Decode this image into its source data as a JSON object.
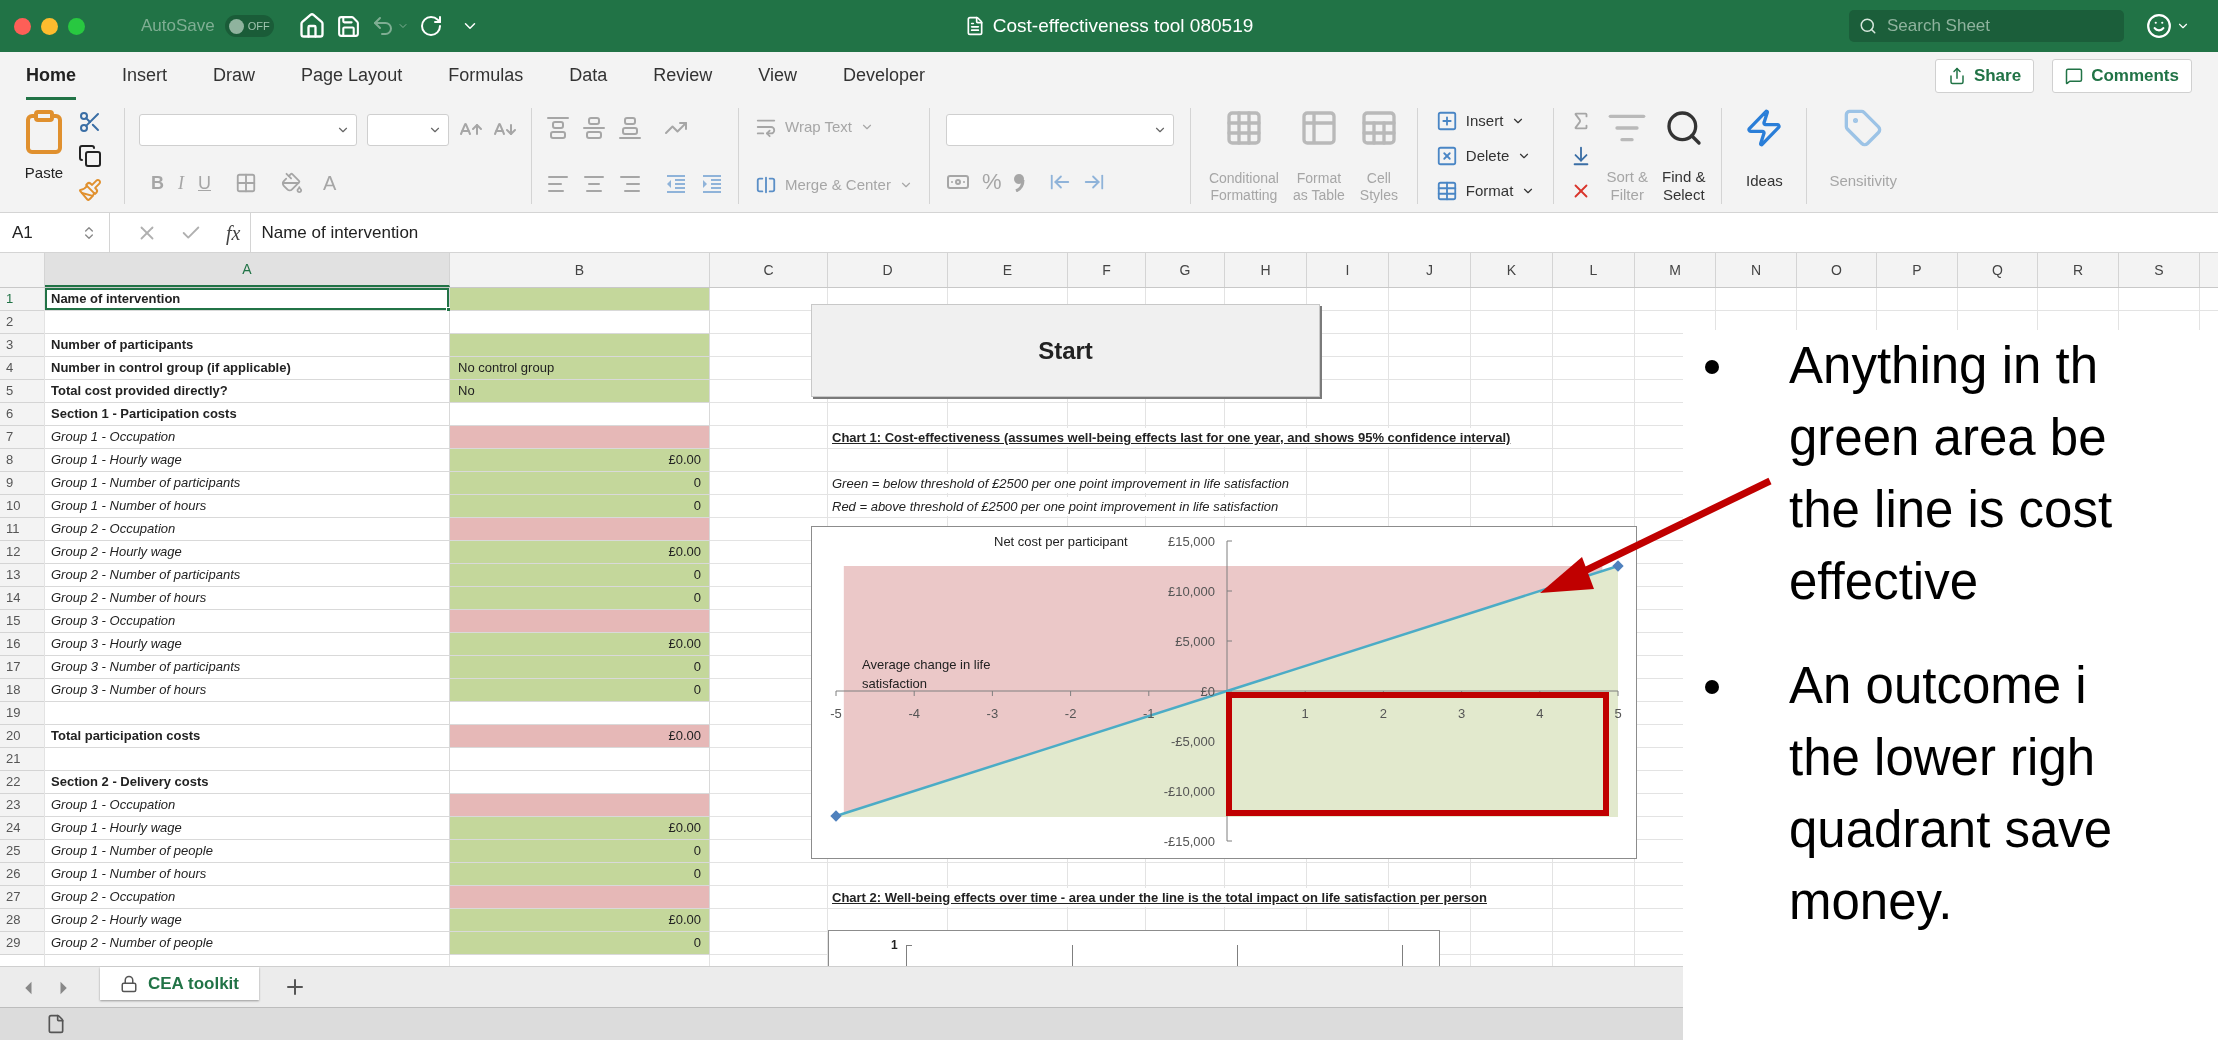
{
  "window": {
    "autosave_label": "AutoSave",
    "autosave_state": "OFF",
    "title": "Cost-effectiveness tool 080519",
    "search_placeholder": "Search Sheet"
  },
  "ribbon_tabs": [
    {
      "label": "Home",
      "selected": true
    },
    {
      "label": "Insert",
      "selected": false
    },
    {
      "label": "Draw",
      "selected": false
    },
    {
      "label": "Page Layout",
      "selected": false
    },
    {
      "label": "Formulas",
      "selected": false
    },
    {
      "label": "Data",
      "selected": false
    },
    {
      "label": "Review",
      "selected": false
    },
    {
      "label": "View",
      "selected": false
    },
    {
      "label": "Developer",
      "selected": false
    }
  ],
  "share_button": "Share",
  "comments_button": "Comments",
  "ribbon": {
    "paste": "Paste",
    "font_buttons": [
      {
        "label": "B",
        "disabled": true
      },
      {
        "label": "I",
        "disabled": true
      },
      {
        "label": "U",
        "disabled": true
      }
    ],
    "font_color": "A",
    "wrap_text": {
      "label": "Wrap Text",
      "disabled": true
    },
    "merge_center": {
      "label": "Merge & Center",
      "disabled": true
    },
    "percent": "%",
    "styles": [
      {
        "lines": [
          "Conditional",
          "Formatting"
        ],
        "disabled": true
      },
      {
        "lines": [
          "Format",
          "as Table"
        ],
        "disabled": true
      },
      {
        "lines": [
          "Cell",
          "Styles"
        ],
        "disabled": true
      }
    ],
    "cells": [
      {
        "label": "Insert",
        "disabled": false
      },
      {
        "label": "Delete",
        "disabled": false
      },
      {
        "label": "Format",
        "disabled": false
      }
    ],
    "editing": [
      {
        "lines": [
          "Sort &",
          "Filter"
        ],
        "disabled": true
      },
      {
        "lines": [
          "Find &",
          "Select"
        ],
        "disabled": false
      }
    ],
    "ideas": {
      "label": "Ideas",
      "disabled": false
    },
    "sensitivity": {
      "label": "Sensitivity",
      "disabled": true
    }
  },
  "formula_bar": {
    "name_box": "A1",
    "fx": "fx",
    "content": "Name of intervention"
  },
  "columns": [
    {
      "label": "A",
      "selected": true
    },
    {
      "label": "B",
      "selected": false
    },
    {
      "label": "C",
      "selected": false
    },
    {
      "label": "D",
      "selected": false
    },
    {
      "label": "E",
      "selected": false
    },
    {
      "label": "F",
      "selected": false
    },
    {
      "label": "G",
      "selected": false
    },
    {
      "label": "H",
      "selected": false
    },
    {
      "label": "I",
      "selected": false
    },
    {
      "label": "J",
      "selected": false
    },
    {
      "label": "K",
      "selected": false
    },
    {
      "label": "L",
      "selected": false
    },
    {
      "label": "M",
      "selected": false
    },
    {
      "label": "N",
      "selected": false
    },
    {
      "label": "O",
      "selected": false
    },
    {
      "label": "P",
      "selected": false
    },
    {
      "label": "Q",
      "selected": false
    },
    {
      "label": "R",
      "selected": false
    },
    {
      "label": "S",
      "selected": false
    }
  ],
  "rows": [
    {
      "number": "1",
      "a": {
        "text": "Name of intervention",
        "bold": true,
        "italic": false,
        "selected": true
      },
      "b": {
        "color": "#c4d79b"
      }
    },
    {
      "number": "2",
      "a": {
        "selected": false
      },
      "b": {}
    },
    {
      "number": "3",
      "a": {
        "text": "Number of participants",
        "bold": true,
        "italic": false,
        "selected": false
      },
      "b": {
        "color": "#c4d79b"
      }
    },
    {
      "number": "4",
      "a": {
        "text": "Number in control group (if applicable)",
        "bold": true,
        "italic": false,
        "selected": false
      },
      "b": {
        "text": "No control group",
        "right_aligned": false,
        "color": "#c4d79b"
      }
    },
    {
      "number": "5",
      "a": {
        "text": "Total cost provided directly?",
        "bold": true,
        "italic": false,
        "selected": false
      },
      "b": {
        "text": "No",
        "right_aligned": false,
        "color": "#c4d79b"
      }
    },
    {
      "number": "6",
      "a": {
        "text": "Section 1 - Participation costs",
        "bold": true,
        "italic": false,
        "selected": false
      },
      "b": {}
    },
    {
      "number": "7",
      "a": {
        "text": "Group 1 - Occupation",
        "bold": false,
        "italic": true,
        "selected": false
      },
      "b": {
        "color": "#e6b8b7"
      },
      "d": {
        "text": "Chart 1: Cost-effectiveness (assumes well-being effects last for one year, and shows 95% confidence interval)",
        "bold": true,
        "italic": false,
        "underline": true
      }
    },
    {
      "number": "8",
      "a": {
        "text": "Group 1 - Hourly wage",
        "bold": false,
        "italic": true,
        "selected": false
      },
      "b": {
        "text": "£0.00",
        "right_aligned": true,
        "color": "#c4d79b"
      }
    },
    {
      "number": "9",
      "a": {
        "text": "Group 1 - Number of participants",
        "bold": false,
        "italic": true,
        "selected": false
      },
      "b": {
        "text": "0",
        "right_aligned": true,
        "color": "#c4d79b"
      },
      "d": {
        "text": "Green = below threshold of £2500 per one point improvement in life satisfaction",
        "bold": false,
        "italic": true,
        "underline": false
      }
    },
    {
      "number": "10",
      "a": {
        "text": "Group 1 - Number of hours",
        "bold": false,
        "italic": true,
        "selected": false
      },
      "b": {
        "text": "0",
        "right_aligned": true,
        "color": "#c4d79b"
      },
      "d": {
        "text": "Red = above threshold of £2500 per one point improvement in life satisfaction",
        "bold": false,
        "italic": true,
        "underline": false
      }
    },
    {
      "number": "11",
      "a": {
        "text": "Group 2 - Occupation",
        "bold": false,
        "italic": true,
        "selected": false
      },
      "b": {
        "color": "#e6b8b7"
      }
    },
    {
      "number": "12",
      "a": {
        "text": "Group 2 - Hourly wage",
        "bold": false,
        "italic": true,
        "selected": false
      },
      "b": {
        "text": "£0.00",
        "right_aligned": true,
        "color": "#c4d79b"
      }
    },
    {
      "number": "13",
      "a": {
        "text": "Group 2 - Number of participants",
        "bold": false,
        "italic": true,
        "selected": false
      },
      "b": {
        "text": "0",
        "right_aligned": true,
        "color": "#c4d79b"
      }
    },
    {
      "number": "14",
      "a": {
        "text": "Group 2 - Number of hours",
        "bold": false,
        "italic": true,
        "selected": false
      },
      "b": {
        "text": "0",
        "right_aligned": true,
        "color": "#c4d79b"
      }
    },
    {
      "number": "15",
      "a": {
        "text": "Group 3 - Occupation",
        "bold": false,
        "italic": true,
        "selected": false
      },
      "b": {
        "color": "#e6b8b7"
      }
    },
    {
      "number": "16",
      "a": {
        "text": "Group 3 - Hourly wage",
        "bold": false,
        "italic": true,
        "selected": false
      },
      "b": {
        "text": "£0.00",
        "right_aligned": true,
        "color": "#c4d79b"
      }
    },
    {
      "number": "17",
      "a": {
        "text": "Group 3 - Number of participants",
        "bold": false,
        "italic": true,
        "selected": false
      },
      "b": {
        "text": "0",
        "right_aligned": true,
        "color": "#c4d79b"
      }
    },
    {
      "number": "18",
      "a": {
        "text": "Group 3 - Number of hours",
        "bold": false,
        "italic": true,
        "selected": false
      },
      "b": {
        "text": "0",
        "right_aligned": true,
        "color": "#c4d79b"
      }
    },
    {
      "number": "19",
      "a": {
        "selected": false
      },
      "b": {}
    },
    {
      "number": "20",
      "a": {
        "text": "Total participation costs",
        "bold": true,
        "italic": false,
        "selected": false
      },
      "b": {
        "text": "£0.00",
        "right_aligned": true,
        "color": "#e6b8b7"
      }
    },
    {
      "number": "21",
      "a": {
        "selected": false
      },
      "b": {}
    },
    {
      "number": "22",
      "a": {
        "text": "Section 2 - Delivery costs",
        "bold": true,
        "italic": false,
        "selected": false
      },
      "b": {}
    },
    {
      "number": "23",
      "a": {
        "text": "Group 1 - Occupation",
        "bold": false,
        "italic": true,
        "selected": false
      },
      "b": {
        "color": "#e6b8b7"
      }
    },
    {
      "number": "24",
      "a": {
        "text": "Group 1 - Hourly wage",
        "bold": false,
        "italic": true,
        "selected": false
      },
      "b": {
        "text": "£0.00",
        "right_aligned": true,
        "color": "#c4d79b"
      }
    },
    {
      "number": "25",
      "a": {
        "text": "Group 1 - Number of people",
        "bold": false,
        "italic": true,
        "selected": false
      },
      "b": {
        "text": "0",
        "right_aligned": true,
        "color": "#c4d79b"
      }
    },
    {
      "number": "26",
      "a": {
        "text": "Group 1 - Number of hours",
        "bold": false,
        "italic": true,
        "selected": false
      },
      "b": {
        "text": "0",
        "right_aligned": true,
        "color": "#c4d79b"
      }
    },
    {
      "number": "27",
      "a": {
        "text": "Group 2 - Occupation",
        "bold": false,
        "italic": true,
        "selected": false
      },
      "b": {
        "color": "#e6b8b7"
      },
      "d": {
        "text": "Chart 2: Well-being effects over time - area under the line is the total impact on life satisfaction per person",
        "bold": true,
        "italic": false,
        "underline": true
      }
    },
    {
      "number": "28",
      "a": {
        "text": "Group 2 - Hourly wage",
        "bold": false,
        "italic": true,
        "selected": false
      },
      "b": {
        "text": "£0.00",
        "right_aligned": true,
        "color": "#c4d79b"
      }
    },
    {
      "number": "29",
      "a": {
        "text": "Group 2 - Number of people",
        "bold": false,
        "italic": true,
        "selected": false
      },
      "b": {
        "text": "0",
        "right_aligned": true,
        "color": "#c4d79b"
      }
    }
  ],
  "start_button": "Start",
  "chart_1": {
    "chart_data": {
      "type": "area",
      "xlabel": "Average change in life satisfaction",
      "ylabel": "Net cost per participant",
      "x": [
        -5,
        5
      ],
      "series": [
        {
          "color": "#4bacc6",
          "marker": "diamond",
          "values": [
            -12500,
            12500
          ]
        }
      ],
      "bands": [
        {
          "axis": "y",
          "from": -12500,
          "to": 12500,
          "color": "#ebc8c8"
        }
      ],
      "xlim": [
        -5,
        5
      ],
      "ylim": [
        -15000,
        15000
      ],
      "xticks": [
        {
          "value": -5,
          "label": "-5"
        },
        {
          "value": -4,
          "label": "-4"
        },
        {
          "value": -3,
          "label": "-3"
        },
        {
          "value": -2,
          "label": "-2"
        },
        {
          "value": -1,
          "label": "-1"
        },
        {
          "value": 1,
          "label": "1"
        },
        {
          "value": 2,
          "label": "2"
        },
        {
          "value": 3,
          "label": "3"
        },
        {
          "value": 4,
          "label": "4"
        },
        {
          "value": 5,
          "label": "5"
        }
      ],
      "yticks": [
        {
          "value": 15000,
          "label": "£15,000"
        },
        {
          "value": 10000,
          "label": "£10,000"
        },
        {
          "value": 5000,
          "label": "£5,000"
        },
        {
          "value": 0,
          "label": "£0"
        },
        {
          "value": -5000,
          "label": "-£5,000"
        },
        {
          "value": -10000,
          "label": "-£10,000"
        },
        {
          "value": -15000,
          "label": "-£15,000"
        }
      ]
    }
  },
  "chart_2": {
    "tick_label": "1"
  },
  "sheet_tabs": [
    {
      "label": "CEA toolkit",
      "selected": true,
      "locked": true
    }
  ],
  "slide": {
    "bullets": [
      {
        "lines": [
          "Anything in th",
          "green area be",
          "the line is cost",
          "effective"
        ]
      },
      {
        "lines": [
          "An outcome i",
          "the lower righ",
          "quadrant save",
          "money."
        ]
      }
    ]
  }
}
